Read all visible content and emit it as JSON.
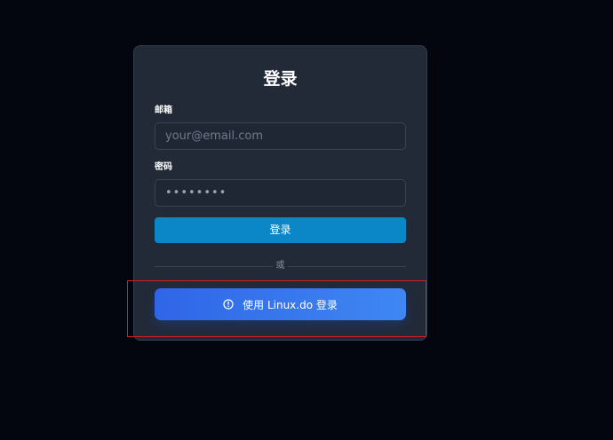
{
  "login": {
    "title": "登录",
    "email_label": "邮箱",
    "email_placeholder": "your@email.com",
    "password_label": "密码",
    "password_value": "••••••••",
    "login_button": "登录",
    "divider_text": "或",
    "linuxdo_button": "使用 Linux.do 登录"
  },
  "icons": {
    "linuxdo_icon": "info-circle-icon"
  },
  "colors": {
    "background": "#03050f",
    "card": "#222a38",
    "login_button": "#0b87c8",
    "linuxdo_button_start": "#2f66e6",
    "linuxdo_button_end": "#3f87f3",
    "highlight_border": "#d42020"
  }
}
